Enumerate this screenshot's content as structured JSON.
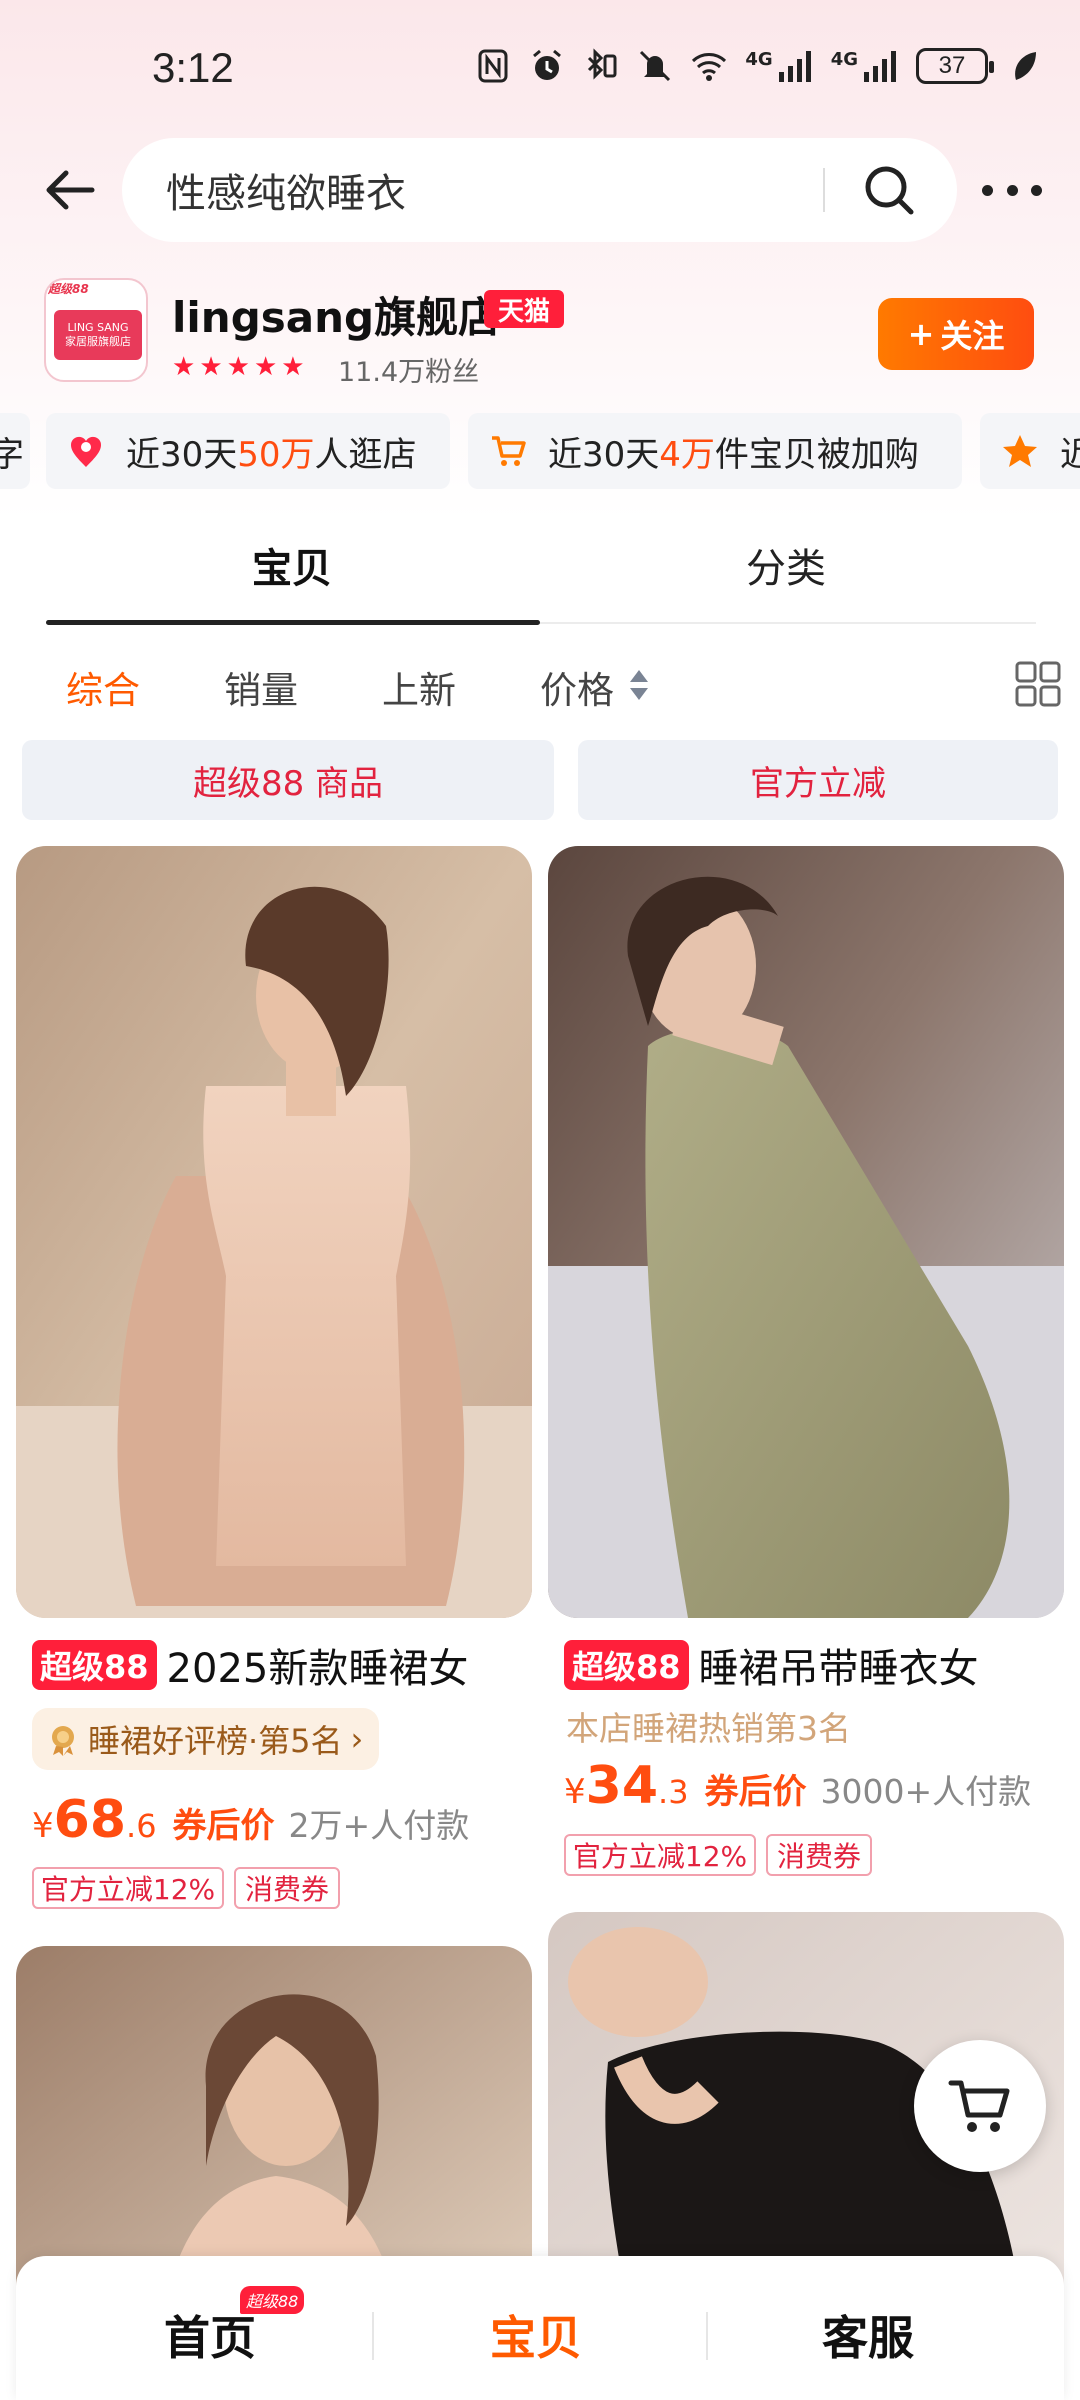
{
  "status_bar": {
    "time": "3:12",
    "battery": "37",
    "signal1_label": "4G",
    "signal2_label": "4G"
  },
  "search": {
    "query": "性感纯欲睡衣"
  },
  "store": {
    "name": "lingsang旗舰店",
    "platform_badge": "天猫",
    "logo_badge": "超级88",
    "logo_brand": "LING SANG",
    "logo_subtitle": "家居服旗舰店",
    "fans": "11.4万粉丝",
    "follow_label": "关注",
    "rating_stars": 5,
    "colors": {
      "accent": "#ff4d10",
      "tmall": "#ff1f3a"
    }
  },
  "stats": [
    {
      "pre": "近30天",
      "hl": "50万",
      "post": "人逛店",
      "icon": "heart-pin-icon"
    },
    {
      "pre": "近30天",
      "hl": "4万",
      "post": "件宝贝被加购",
      "icon": "cart-icon"
    },
    {
      "pre": "近",
      "hl": "",
      "post": "",
      "icon": "star-icon"
    }
  ],
  "tabs": {
    "products": "宝贝",
    "categories": "分类"
  },
  "sort": {
    "comprehensive": "综合",
    "sales": "销量",
    "new": "上新",
    "price": "价格"
  },
  "filters": {
    "super88": "超级88 商品",
    "official_discount": "官方立减"
  },
  "products": [
    {
      "badge": "超级88",
      "title": "2025新款睡裙女",
      "rank": "睡裙好评榜·第5名",
      "price_int": "68",
      "price_dec": ".6",
      "price_label": "券后价",
      "sales": "2万+人付款",
      "tags": [
        "官方立减12%",
        "消费券"
      ]
    },
    {
      "badge": "超级88",
      "title": "睡裙吊带睡衣女",
      "rank": "本店睡裙热销第3名",
      "price_int": "34",
      "price_dec": ".3",
      "price_label": "券后价",
      "sales": "3000+人付款",
      "tags": [
        "官方立减12%",
        "消费券"
      ]
    }
  ],
  "currency": "¥",
  "bottom_nav": {
    "home": "首页",
    "home_badge": "超级88",
    "products": "宝贝",
    "service": "客服"
  }
}
